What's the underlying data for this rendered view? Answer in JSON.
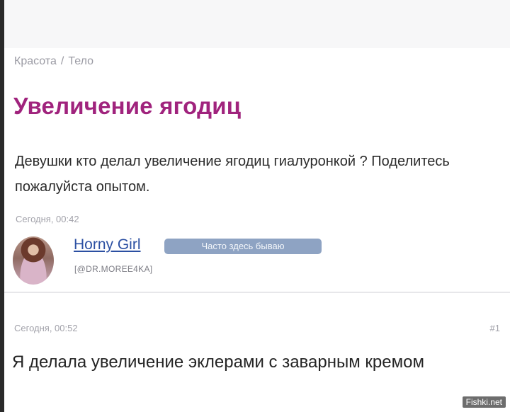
{
  "breadcrumb": {
    "category": "Красота",
    "separator": "/",
    "subcategory": "Тело"
  },
  "question": {
    "title": "Увеличение ягодиц",
    "body": "Девушки кто делал увеличение ягодиц гиалуронкой ? Поделитесь пожалуйста опытом.",
    "timestamp": "Сегодня, 00:42"
  },
  "author": {
    "username": "Horny Girl",
    "handle": "[@DR.MOREE4KA]",
    "badge": "Часто здесь бываю"
  },
  "answer": {
    "timestamp": "Сегодня, 00:52",
    "number": "#1",
    "body": "Я делала увеличение эклерами с заварным кремом"
  },
  "watermark": "Fishki.net",
  "colors": {
    "title": "#a0237d",
    "username": "#2b4fa2",
    "badge": "#8ea3c3"
  }
}
